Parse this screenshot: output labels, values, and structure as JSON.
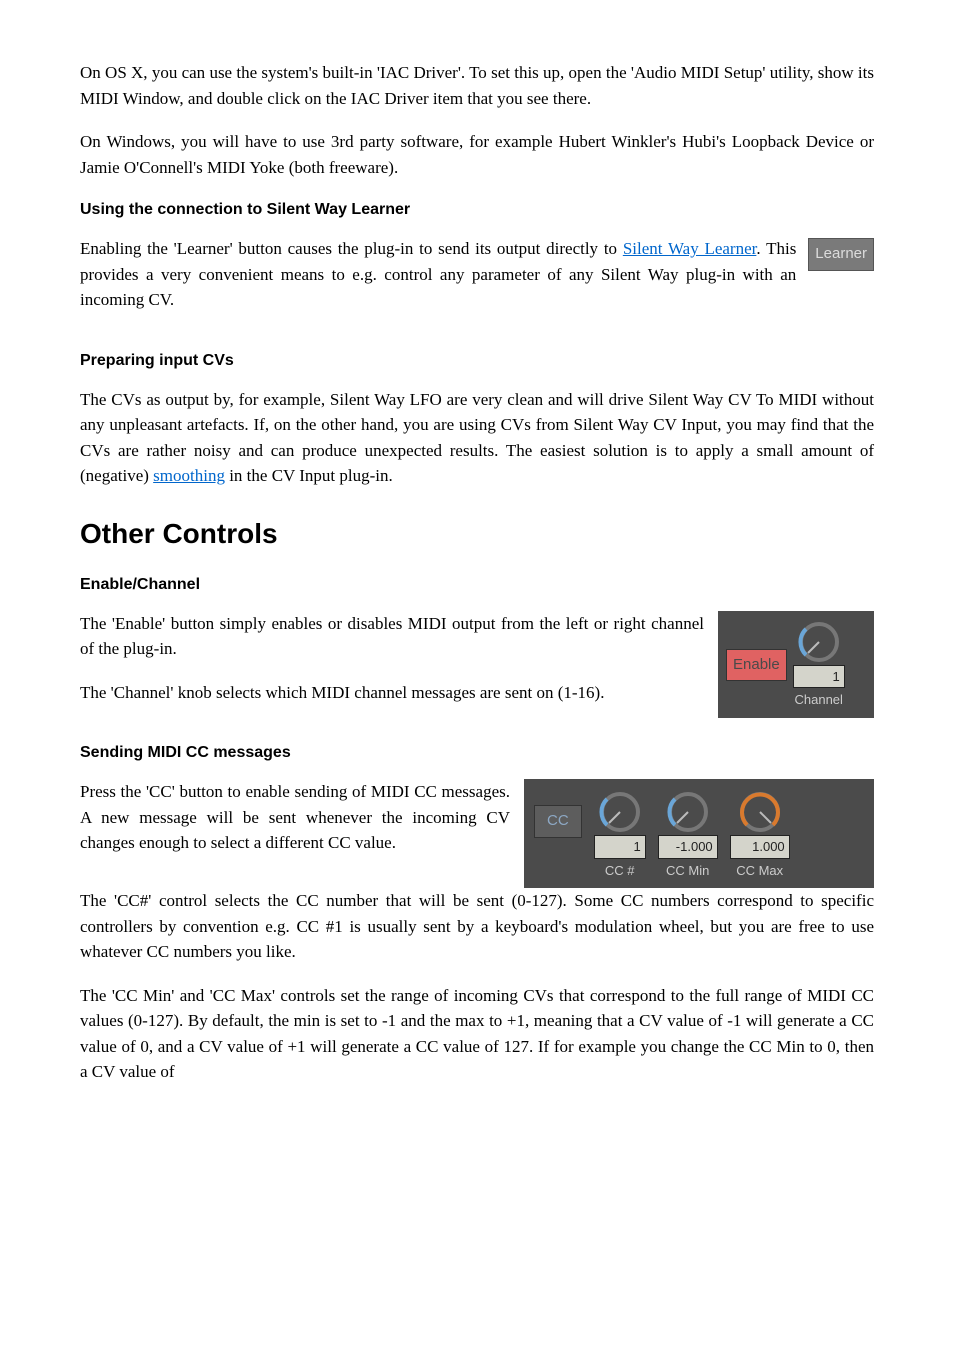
{
  "p1": "On OS X, you can use the system's built-in 'IAC Driver'. To set this up, open the 'Audio MIDI Setup' utility, show its MIDI Window, and double click on the IAC Driver item that you see there.",
  "p2": "On Windows, you will have to use 3rd party software, for example Hubert Winkler's Hubi's Loopback Device or Jamie O'Connell's MIDI Yoke (both freeware).",
  "h1": "Using the connection to Silent Way Learner",
  "p3a": "Enabling the 'Learner' button causes the plug-in to send its output directly to ",
  "p3link": "Silent Way Learner",
  "p3b": ". This provides a very convenient means to e.g. control any parameter of any Silent Way plug-in with an incoming CV.",
  "learner_btn": "Learner",
  "h2": "Preparing input CVs",
  "p4a": "The CVs as output by, for example, Silent Way LFO are very clean and will drive Silent Way CV To MIDI without any unpleasant artefacts. If, on the other hand, you are using CVs from Silent Way CV Input, you may find that the CVs are rather noisy and can produce unexpected results. The easiest solution is to apply a small amount of (negative) ",
  "p4link": "smoothing",
  "p4b": " in the CV Input plug-in.",
  "section": "Other Controls",
  "h3": "Enable/Channel",
  "p5": "The 'Enable' button simply enables or disables MIDI output from the left or right channel of the plug-in.",
  "p6": "The 'Channel' knob selects which MIDI channel messages are sent on (1-16).",
  "enable_btn": "Enable",
  "channel_value": "1",
  "channel_label": "Channel",
  "h4": "Sending MIDI CC messages",
  "p7": "Press the 'CC' button to enable sending of MIDI CC messages. A new message will be sent whenever the incoming CV changes enough to select a different CC value.",
  "p8": "The 'CC#' control selects the CC number that will be sent (0-127). Some CC numbers correspond to specific controllers by convention e.g. CC #1 is usually sent by a keyboard's modulation wheel, but you are free to use whatever CC numbers you like.",
  "cc_btn": "CC",
  "ccnum_value": "1",
  "ccnum_label": "CC #",
  "ccmin_value": "-1.000",
  "ccmin_label": "CC Min",
  "ccmax_value": "1.000",
  "ccmax_label": "CC Max",
  "p9": "The 'CC Min' and 'CC Max' controls set the range of incoming CVs that correspond to the full range of MIDI CC values (0-127). By default, the min is set to -1 and the max to +1, meaning that a CV value of -1 will generate a CC value of 0, and a CV value of +1 will generate a CC value of 127. If for example you change the CC Min to 0, then a CV value of"
}
